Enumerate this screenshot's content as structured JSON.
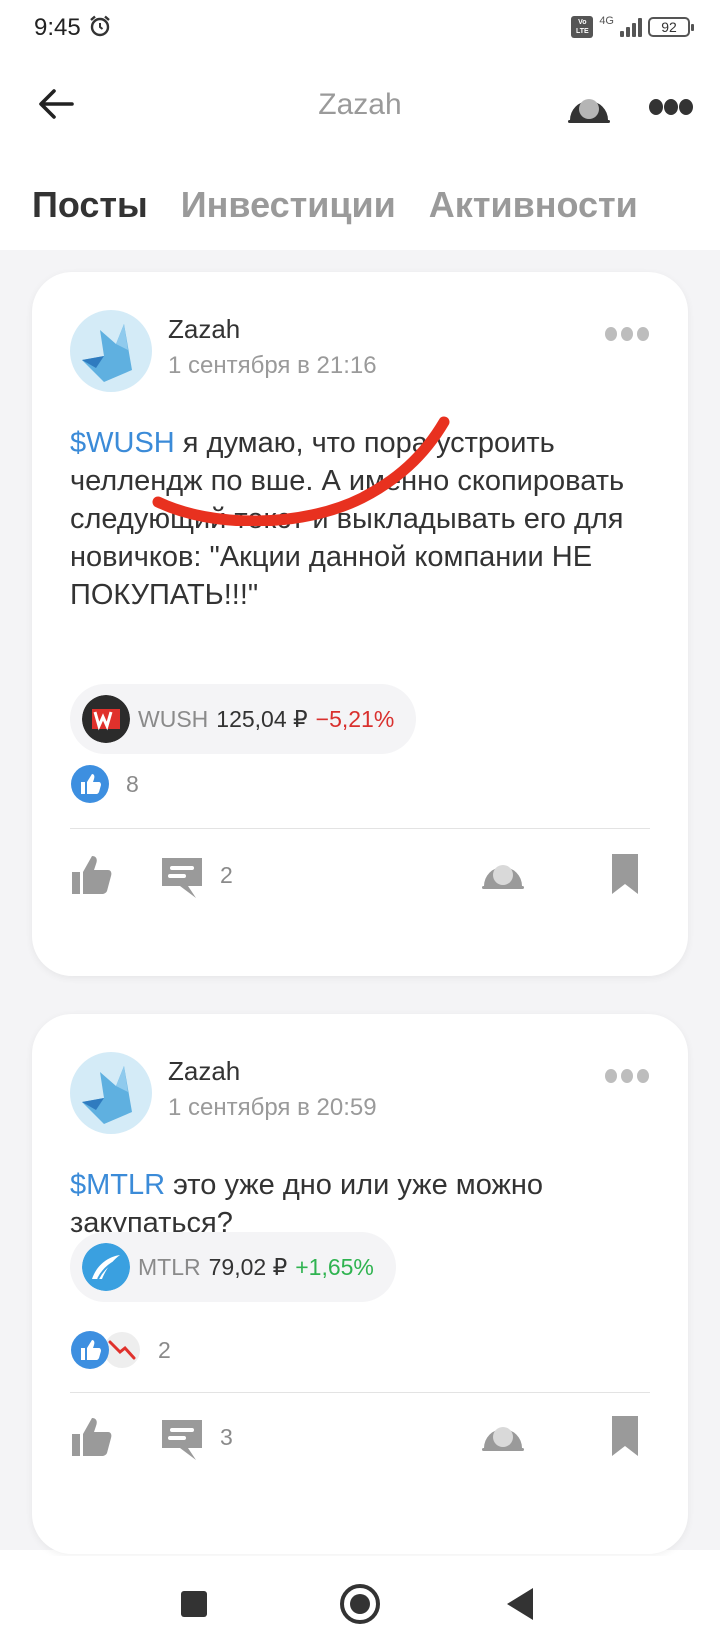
{
  "status_bar": {
    "time": "9:45",
    "volte": "Vo LTE",
    "network": "4G",
    "battery": "92",
    "icons": [
      "alarm-icon",
      "volte-icon",
      "signal-icon",
      "battery-icon"
    ]
  },
  "header": {
    "title": "Zazah",
    "icons": [
      "back-arrow-icon",
      "share-icon",
      "more-icon"
    ]
  },
  "tabs": [
    {
      "label": "Посты",
      "active": true
    },
    {
      "label": "Инвестиции",
      "active": false
    },
    {
      "label": "Активности",
      "active": false
    }
  ],
  "posts": [
    {
      "author": "Zazah",
      "date": "1 сентября в 21:16",
      "ticker": "$WUSH",
      "text": " я думаю, что пора устроить челлендж по вше. А именно скопировать следующий текст и выкладывать его для новичков: \"Акции данной компании НЕ ПОКУПАТЬ!!!\"",
      "quote": {
        "ticker": "WUSH",
        "price": "125,04 ₽",
        "change": "−5,21%",
        "trend": "down",
        "logo_color": "#2b2b2b",
        "accent": "#e0312c"
      },
      "reactions_count": "8",
      "comments_count": "2",
      "annotation": "red-freehand-strikethrough"
    },
    {
      "author": "Zazah",
      "date": "1 сентября в 20:59",
      "ticker": "$MTLR",
      "text": " это уже дно или уже можно закупаться?",
      "quote": {
        "ticker": "MTLR",
        "price": "79,02 ₽",
        "change": "+1,65%",
        "trend": "up",
        "logo_color": "#3aa0e0"
      },
      "reactions_count": "2",
      "comments_count": "3"
    }
  ],
  "colors": {
    "link": "#3b8bd8",
    "negative": "#d9302e",
    "positive": "#2fb350",
    "muted": "#9a9a9a",
    "feed_background": "#f4f4f6"
  },
  "system_nav": {
    "icons": [
      "recents-icon",
      "home-icon",
      "back-icon"
    ]
  }
}
